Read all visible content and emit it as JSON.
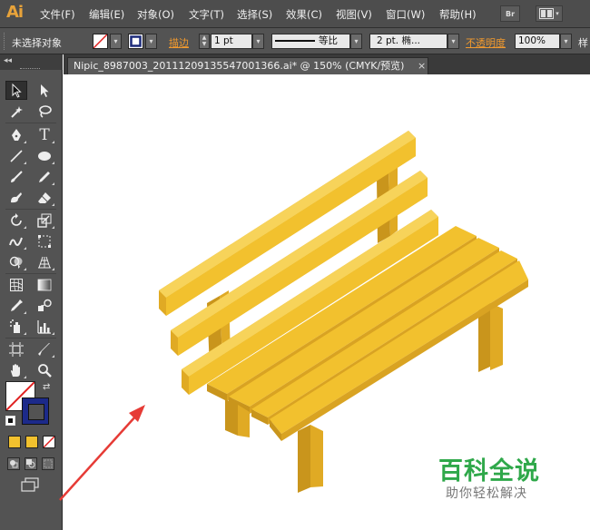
{
  "app": {
    "logo": "Ai"
  },
  "menu": [
    {
      "label": "文件(F)"
    },
    {
      "label": "编辑(E)"
    },
    {
      "label": "对象(O)"
    },
    {
      "label": "文字(T)"
    },
    {
      "label": "选择(S)"
    },
    {
      "label": "效果(C)"
    },
    {
      "label": "视图(V)"
    },
    {
      "label": "窗口(W)"
    },
    {
      "label": "帮助(H)"
    }
  ],
  "menubar_buttons": {
    "bridge_label": "Br"
  },
  "control": {
    "selection_status": "未选择对象",
    "stroke_label": "描边",
    "stroke_weight": "1 pt",
    "profile_label": "等比",
    "brush_label": "2 pt. 椭...",
    "opacity_label": "不透明度",
    "opacity_value": "100%",
    "style_label": "样"
  },
  "document": {
    "tab_title": "Nipic_8987003_20111209135547001366.ai* @ 150% (CMYK/预览)",
    "close_glyph": "×"
  },
  "colors": {
    "accent_logo": "#e8a33a",
    "bench_main": "#f2c12e",
    "bench_dark": "#c9951c",
    "bench_shadow": "#e0aa24",
    "arrow": "#e63b36",
    "watermark": "#2fa84a"
  },
  "watermark": {
    "main": "百科全说",
    "sub": "助你轻松解决"
  },
  "toolbar": {
    "tools": [
      "selection-tool",
      "direct-selection-tool",
      "magic-wand-tool",
      "lasso-tool",
      "pen-tool",
      "type-tool",
      "line-tool",
      "ellipse-tool",
      "paintbrush-tool",
      "pencil-tool",
      "blob-brush-tool",
      "eraser-tool",
      "rotate-tool",
      "scale-tool",
      "warp-tool",
      "free-transform-tool",
      "shape-builder-tool",
      "perspective-grid-tool",
      "mesh-tool",
      "gradient-tool",
      "eyedropper-tool",
      "blend-tool",
      "symbol-sprayer-tool",
      "column-graph-tool",
      "artboard-tool",
      "slice-tool",
      "hand-tool",
      "zoom-tool"
    ]
  }
}
